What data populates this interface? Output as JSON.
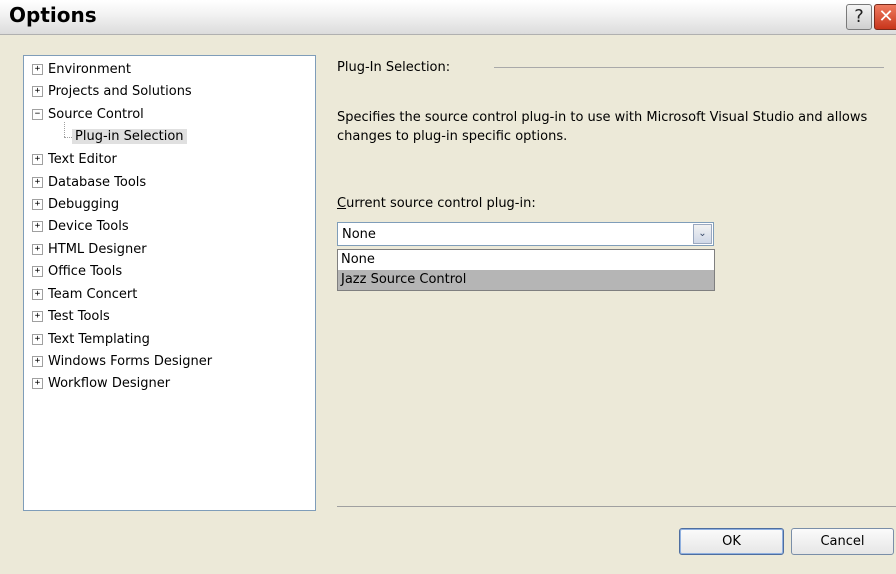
{
  "window": {
    "title": "Options",
    "help_glyph": "?",
    "close_glyph": "✕"
  },
  "tree": {
    "items": [
      {
        "label": "Environment",
        "expander": "+"
      },
      {
        "label": "Projects and Solutions",
        "expander": "+"
      },
      {
        "label": "Source Control",
        "expander": "−"
      },
      {
        "label": "Text Editor",
        "expander": "+"
      },
      {
        "label": "Database Tools",
        "expander": "+"
      },
      {
        "label": "Debugging",
        "expander": "+"
      },
      {
        "label": "Device Tools",
        "expander": "+"
      },
      {
        "label": "HTML Designer",
        "expander": "+"
      },
      {
        "label": "Office Tools",
        "expander": "+"
      },
      {
        "label": "Team Concert",
        "expander": "+"
      },
      {
        "label": "Test Tools",
        "expander": "+"
      },
      {
        "label": "Text Templating",
        "expander": "+"
      },
      {
        "label": "Windows Forms Designer",
        "expander": "+"
      },
      {
        "label": "Workflow Designer",
        "expander": "+"
      }
    ],
    "selected_child": "Plug-in Selection"
  },
  "panel": {
    "section_title": "Plug-In Selection:",
    "description": "Specifies the source control plug-in to use with Microsoft Visual Studio and allows changes to plug-in specific options.",
    "field_label_accel": "C",
    "field_label_rest": "urrent source control plug-in:",
    "select_value": "None",
    "select_arrow": "⌄",
    "options": [
      "None",
      "Jazz Source Control"
    ]
  },
  "buttons": {
    "ok": "OK",
    "cancel": "Cancel"
  }
}
